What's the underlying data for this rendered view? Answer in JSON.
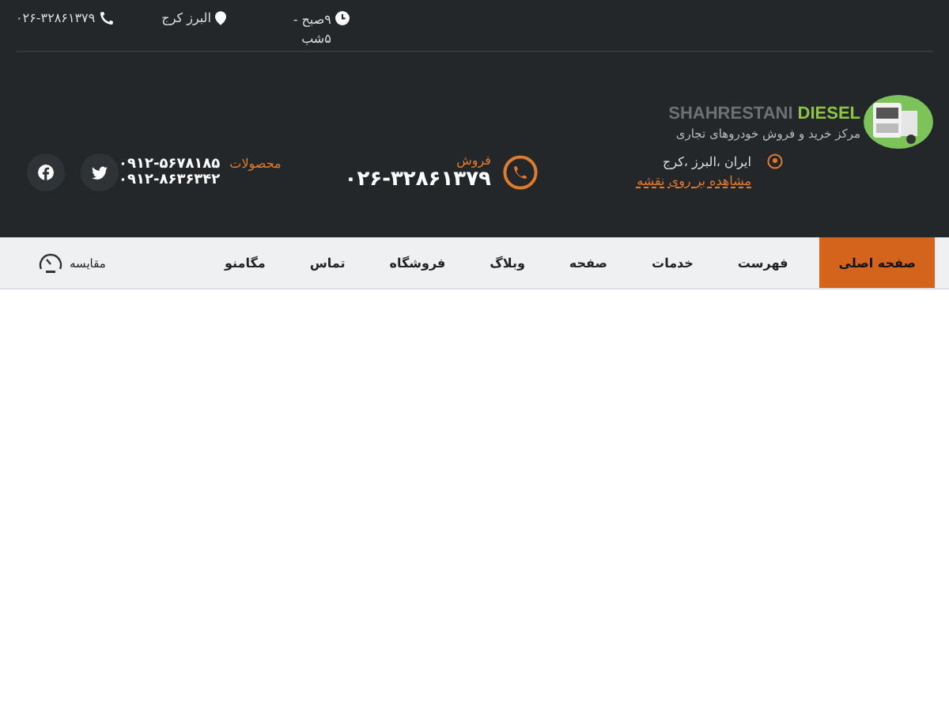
{
  "top_bar": {
    "hours": "۹صبح - ۵شب",
    "location": "البرز کرج",
    "phone": "۰۲۶-۳۲۸۶۱۳۷۹"
  },
  "logo": {
    "name_first": "SHAHRESTANI",
    "name_second": "DIESEL",
    "tagline": "مرکز خرید و فروش خودروهای تجاری"
  },
  "address": {
    "text": "ایران ،البرز ،کرج",
    "link": "مشاهده بر روی نقشه"
  },
  "sales": {
    "label": "فروش",
    "phone": "۰۲۶-۳۲۸۶۱۳۷۹"
  },
  "products": {
    "label": "محصولات",
    "phones": [
      "۰۹۱۲-۵۶۷۸۱۸۵",
      "۰۹۱۲-۸۶۳۶۳۴۲"
    ]
  },
  "social": [
    {
      "kind": "twitter"
    },
    {
      "kind": "facebook"
    }
  ],
  "nav": {
    "items": [
      {
        "label": "صفحه اصلی",
        "selected": true
      },
      {
        "label": "فهرست",
        "selected": false
      },
      {
        "label": "خدمات",
        "selected": false
      },
      {
        "label": "صفحه",
        "selected": false
      },
      {
        "label": "وبلاگ",
        "selected": false
      },
      {
        "label": "فروشگاه",
        "selected": false
      },
      {
        "label": "تماس",
        "selected": false
      },
      {
        "label": "مگامنو",
        "selected": false
      }
    ],
    "compare": "مقایسه"
  }
}
